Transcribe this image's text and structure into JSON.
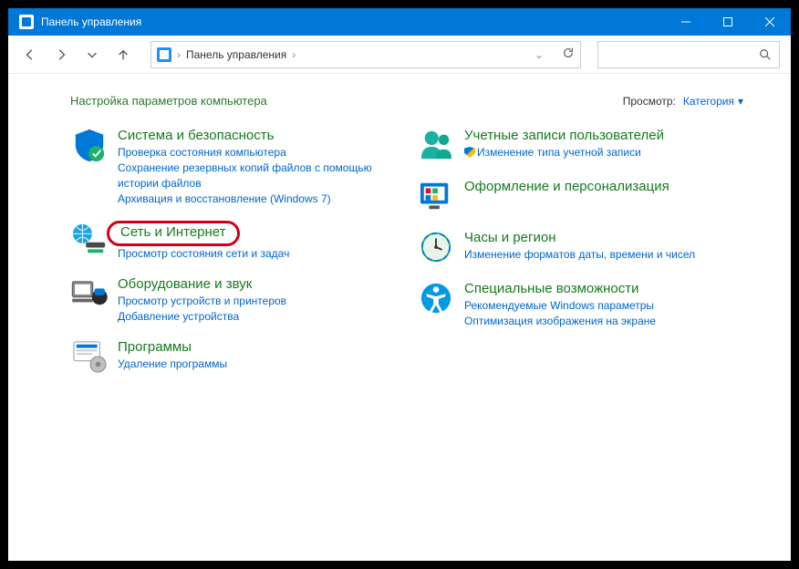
{
  "window": {
    "title": "Панель управления"
  },
  "breadcrumb": {
    "root": "Панель управления"
  },
  "heading": "Настройка параметров компьютера",
  "view": {
    "label": "Просмотр:",
    "value": "Категория"
  },
  "items": {
    "security": {
      "title": "Система и безопасность",
      "subs": [
        "Проверка состояния компьютера",
        "Сохранение резервных копий файлов с помощью истории файлов",
        "Архивация и восстановление (Windows 7)"
      ]
    },
    "network": {
      "title": "Сеть и Интернет",
      "subs": [
        "Просмотр состояния сети и задач"
      ]
    },
    "hardware": {
      "title": "Оборудование и звук",
      "subs": [
        "Просмотр устройств и принтеров",
        "Добавление устройства"
      ]
    },
    "programs": {
      "title": "Программы",
      "subs": [
        "Удаление программы"
      ]
    },
    "accounts": {
      "title": "Учетные записи пользователей",
      "subs": [
        "Изменение типа учетной записи"
      ]
    },
    "appearance": {
      "title": "Оформление и персонализация",
      "subs": []
    },
    "clock": {
      "title": "Часы и регион",
      "subs": [
        "Изменение форматов даты, времени и чисел"
      ]
    },
    "access": {
      "title": "Специальные возможности",
      "subs": [
        "Рекомендуемые Windows параметры",
        "Оптимизация изображения на экране"
      ]
    }
  }
}
